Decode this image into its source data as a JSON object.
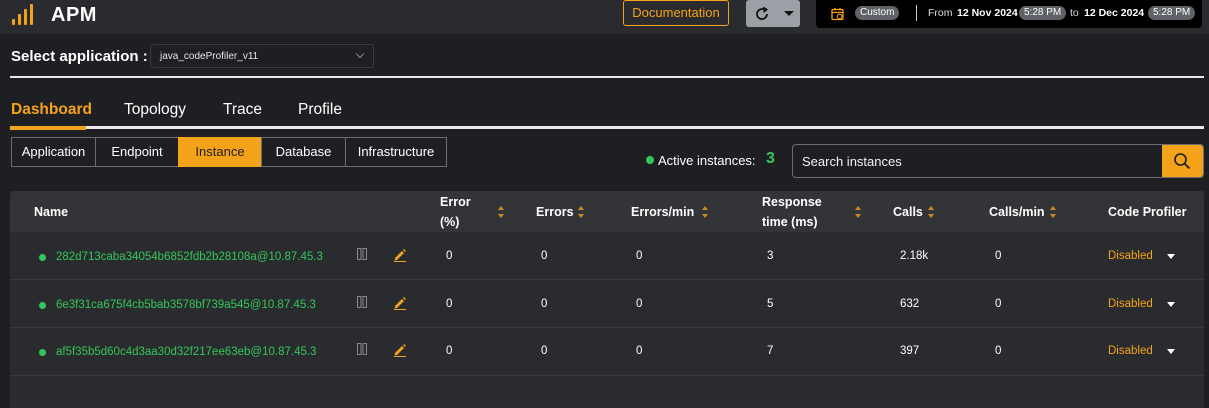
{
  "header": {
    "app_title": "APM",
    "documentation_label": "Documentation",
    "time_range": {
      "mode": "Custom",
      "from_label": "From",
      "from_date": "12 Nov 2024",
      "from_time": "5:28 PM",
      "to_label": "to",
      "to_date": "12 Dec 2024",
      "to_time": "5:28 PM"
    }
  },
  "app_select": {
    "label": "Select application :",
    "value": "java_codeProfiler_v11"
  },
  "main_tabs": [
    "Dashboard",
    "Topology",
    "Trace",
    "Profile"
  ],
  "sub_tabs": [
    "Application",
    "Endpoint",
    "Instance",
    "Database",
    "Infrastructure"
  ],
  "active_instances": {
    "label": "Active instances:",
    "count": "3"
  },
  "search": {
    "placeholder": "Search instances"
  },
  "table": {
    "headers": {
      "name": "Name",
      "error_pct_1": "Error",
      "error_pct_2": "(%)",
      "errors": "Errors",
      "errors_per_min": "Errors/min",
      "response_1": "Response",
      "response_2": "time (ms)",
      "calls": "Calls",
      "calls_per_min": "Calls/min",
      "code_profiler": "Code Profiler"
    },
    "rows": [
      {
        "name": "282d713caba34054b6852fdb2b28108a@10.87.45.3",
        "error_pct": "0",
        "errors": "0",
        "errors_per_min": "0",
        "response_time": "3",
        "calls": "2.18k",
        "calls_per_min": "0",
        "code_profiler": "Disabled"
      },
      {
        "name": "6e3f31ca675f4cb5bab3578bf739a545@10.87.45.3",
        "error_pct": "0",
        "errors": "0",
        "errors_per_min": "0",
        "response_time": "5",
        "calls": "632",
        "calls_per_min": "0",
        "code_profiler": "Disabled"
      },
      {
        "name": "af5f35b5d60c4d3aa30d32f217ee63eb@10.87.45.3",
        "error_pct": "0",
        "errors": "0",
        "errors_per_min": "0",
        "response_time": "7",
        "calls": "397",
        "calls_per_min": "0",
        "code_profiler": "Disabled"
      }
    ]
  },
  "colors": {
    "accent": "#f5a21b",
    "status_ok": "#34c759",
    "background": "#1e1f22"
  }
}
